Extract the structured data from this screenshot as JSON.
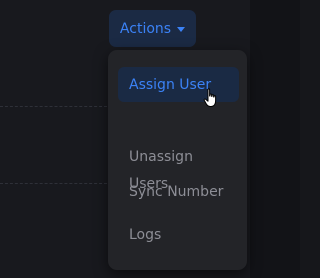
{
  "actions_button": {
    "label": "Actions",
    "icon": "caret-down-icon"
  },
  "menu": {
    "items": [
      {
        "label": "Assign User",
        "state": "hovered"
      },
      {
        "label": "Unassign\nUsers",
        "state": "normal"
      },
      {
        "label": "Sync Number",
        "state": "normal"
      },
      {
        "label": "Logs",
        "state": "normal"
      }
    ]
  },
  "cursor": {
    "icon": "hand-pointer-cursor-icon"
  },
  "colors": {
    "accent": "#3b82f6",
    "background": "#18191e",
    "menu_bg": "#232428",
    "hover_bg": "#1a2a44",
    "text_muted": "#8d8e96"
  }
}
